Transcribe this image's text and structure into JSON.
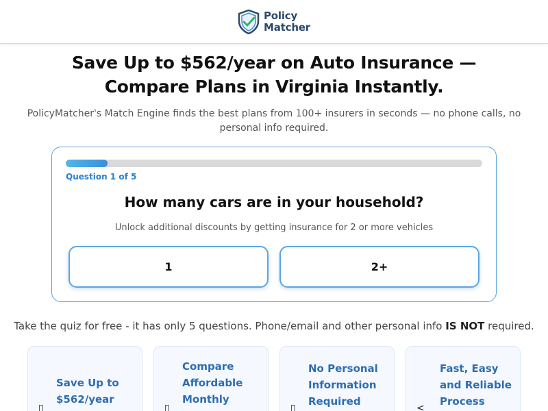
{
  "header": {
    "logo_line1": "Policy",
    "logo_line2": "Matcher"
  },
  "hero": {
    "headline": "Save Up to $562/year on Auto Insurance — Compare Plans in Virginia Instantly.",
    "subhead": "PolicyMatcher's Match Engine finds the best plans from 100+ insurers in seconds — no phone calls, no personal info required."
  },
  "quiz": {
    "progress_fraction": 0.1,
    "question_count": "Question 1 of 5",
    "question": "How many cars are in your household?",
    "hint": "Unlock additional discounts by getting insurance for 2 or more vehicles",
    "answers": [
      "1",
      "2+"
    ]
  },
  "note": {
    "prefix": "Take the quiz for free - it has only 5 questions. Phone/email and other personal info ",
    "emphasis": "IS NOT",
    "suffix": " required."
  },
  "features": [
    {
      "label": "Save Up to $562/year",
      "icon": "money-icon"
    },
    {
      "label": "Compare Affordable Monthly",
      "icon": "compare-icon"
    },
    {
      "label": "No Personal Information Required",
      "icon": "lock-icon"
    },
    {
      "label": "Fast, Easy and Reliable Process",
      "icon": "check-icon"
    }
  ],
  "colors": {
    "brand": "#2d4a6b",
    "accent": "#3a8fdb",
    "feature_text": "#2e6db0"
  }
}
